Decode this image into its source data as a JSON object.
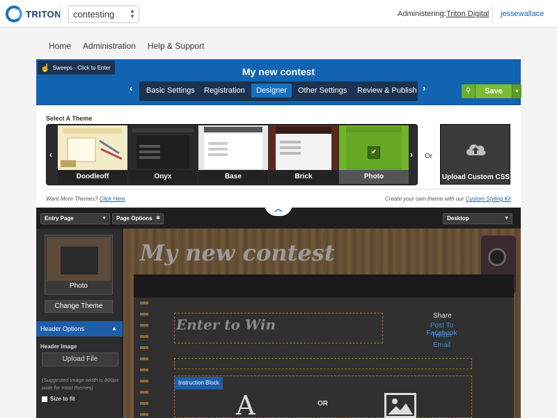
{
  "topbar": {
    "logo_text": "TRITON",
    "station": "contesting",
    "administering_label": "Administering:",
    "administering_value": "Triton Digital",
    "user": "jessewallace"
  },
  "mainnav": [
    "Home",
    "Administration",
    "Help & Support"
  ],
  "contest": {
    "sweeps_label": "Sweeps - Click to Enter",
    "title": "My new contest",
    "steps": [
      "Basic Settings",
      "Registration",
      "Designer",
      "Other Settings",
      "Review & Publish"
    ],
    "active_step": "Designer",
    "save_label": "Save"
  },
  "themes": {
    "select_label": "Select A Theme",
    "items": [
      "Doodleoff",
      "Onyx",
      "Base",
      "Brick",
      "Photo"
    ],
    "selected": "Photo",
    "or_label": "Or",
    "upload_css_label": "Upload Custom CSS",
    "want_more_text": "Want More Themes?",
    "click_here": "Click Here",
    "create_own_text": "Create your own theme with our",
    "custom_styling_kit": "Custom Styling Kit"
  },
  "designer": {
    "page_select": "Entry Page",
    "page_options": "Page Options",
    "device_select": "Desktop",
    "current_theme": "Photo",
    "change_theme": "Change Theme",
    "header_options": "Header Options",
    "header_image_label": "Header Image",
    "upload_file": "Upload File",
    "suggestion": "(Suggested image width is 800px wide for most themes)",
    "size_to_fit": "Size to fit",
    "canvas_title": "My new contest",
    "enter_to_win": "Enter to Win",
    "share_label": "Share",
    "share_links": [
      "Post To Facebook",
      "Twitter",
      "Email"
    ],
    "instruction_block": "Instruction Block",
    "or_mid": "OR",
    "big_letter": "A"
  },
  "colors": {
    "brand_blue": "#1263b0",
    "dark_nav": "#1b3350",
    "save_green": "#79bd33",
    "link_blue": "#1565b4"
  }
}
